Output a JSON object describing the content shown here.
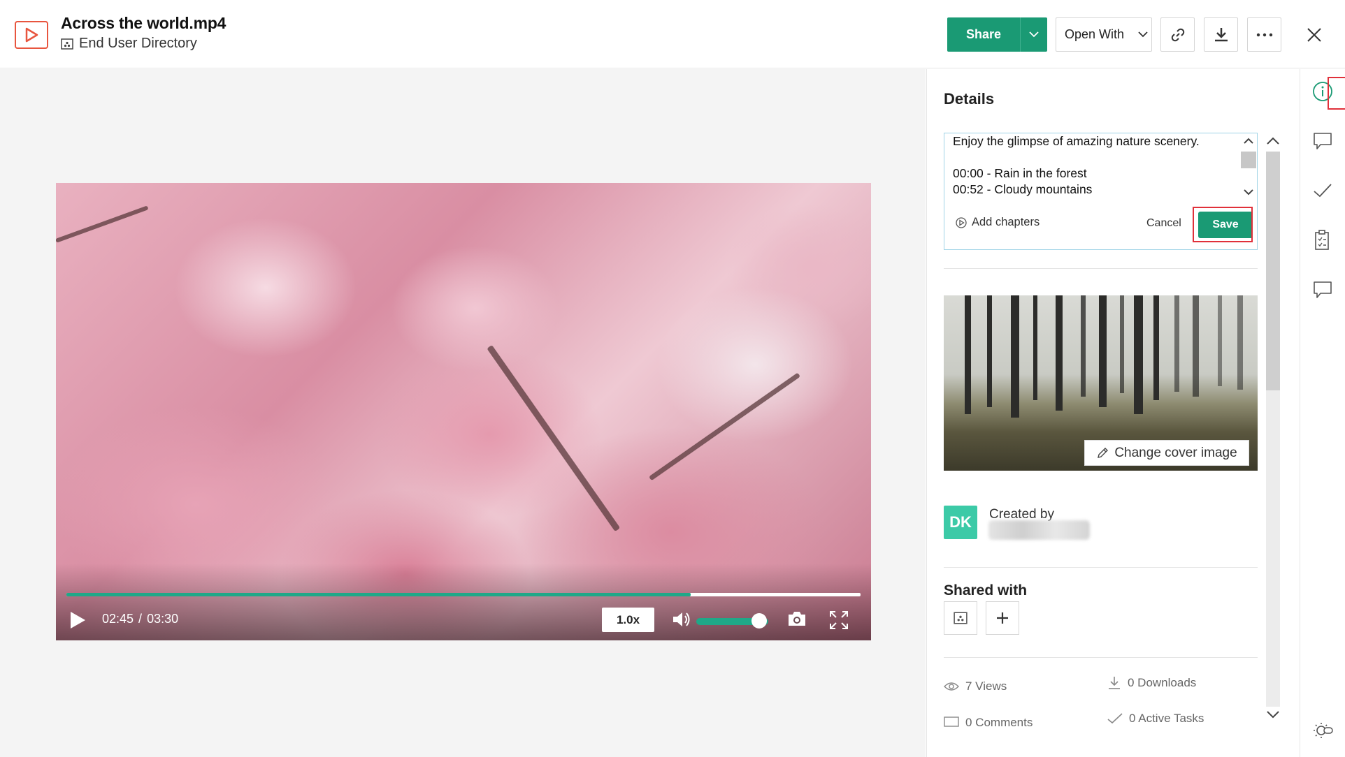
{
  "header": {
    "file_name": "Across the world.mp4",
    "location": "End User Directory",
    "share_label": "Share",
    "open_with_label": "Open With"
  },
  "player": {
    "current_time": "02:45",
    "separator": "/",
    "duration": "03:30",
    "progress_fraction": 0.786,
    "speed": "1.0x",
    "volume_fraction": 0.87
  },
  "details": {
    "title": "Details",
    "description": "Enjoy the glimpse of amazing nature scenery.\n\n00:00 - Rain in the forest\n00:52 - Cloudy mountains",
    "add_chapters_label": "Add chapters",
    "cancel_label": "Cancel",
    "save_label": "Save",
    "change_cover_label": "Change cover image",
    "avatar_initials": "DK",
    "created_by_label": "Created by",
    "shared_with_label": "Shared with",
    "stats": {
      "views": "7 Views",
      "downloads": "0 Downloads",
      "comments": "0 Comments",
      "active_tasks": "0 Active Tasks"
    }
  },
  "colors": {
    "accent": "#1a9a74",
    "highlight": "#e0303a",
    "file_icon": "#e8553e",
    "avatar": "#3ccaa7"
  },
  "icons": {
    "header": [
      "video-file-icon",
      "folder-icon",
      "chevron-down-icon",
      "link-icon",
      "download-icon",
      "more-icon",
      "close-icon"
    ],
    "rail": [
      "info-icon",
      "comment-icon",
      "check-icon",
      "task-list-icon",
      "chat-icon",
      "theme-toggle-icon"
    ]
  }
}
